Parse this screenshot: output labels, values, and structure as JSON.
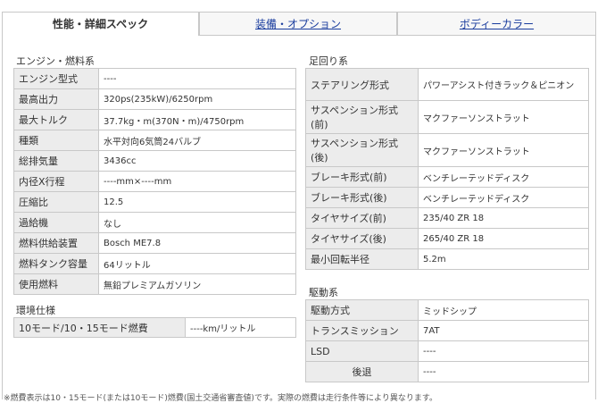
{
  "tabs": [
    {
      "label": "性能・詳細スペック"
    },
    {
      "label": "装備・オプション"
    },
    {
      "label": "ボディーカラー"
    }
  ],
  "engine": {
    "title": "エンジン・燃料系",
    "rows": [
      {
        "label": "エンジン型式",
        "value": "----"
      },
      {
        "label": "最高出力",
        "value": "320ps(235kW)/6250rpm"
      },
      {
        "label": "最大トルク",
        "value": "37.7kg・m(370N・m)/4750rpm"
      },
      {
        "label": "種類",
        "value": "水平対向6気筒24バルブ"
      },
      {
        "label": "総排気量",
        "value": "3436cc"
      },
      {
        "label": "内径X行程",
        "value": "----mm×----mm"
      },
      {
        "label": "圧縮比",
        "value": "12.5"
      },
      {
        "label": "過給機",
        "value": "なし"
      },
      {
        "label": "燃料供給装置",
        "value": "Bosch ME7.8"
      },
      {
        "label": "燃料タンク容量",
        "value": "64リットル"
      },
      {
        "label": "使用燃料",
        "value": "無鉛プレミアムガソリン"
      }
    ]
  },
  "environment": {
    "title": "環境仕様",
    "rows": [
      {
        "label": "10モード/10・15モード燃費",
        "value": "----km/リットル"
      }
    ]
  },
  "suspension": {
    "title": "足回り系",
    "rows": [
      {
        "label": "ステアリング形式",
        "value": "パワーアシスト付きラック＆ピニオン"
      },
      {
        "label": "サスペンション形式(前)",
        "value": "マクファーソンストラット"
      },
      {
        "label": "サスペンション形式(後)",
        "value": "マクファーソンストラット"
      },
      {
        "label": "ブレーキ形式(前)",
        "value": "ベンチレーテッドディスク"
      },
      {
        "label": "ブレーキ形式(後)",
        "value": "ベンチレーテッドディスク"
      },
      {
        "label": "タイヤサイズ(前)",
        "value": "235/40 ZR 18"
      },
      {
        "label": "タイヤサイズ(後)",
        "value": "265/40 ZR 18"
      },
      {
        "label": "最小回転半径",
        "value": "5.2m"
      }
    ]
  },
  "drive": {
    "title": "駆動系",
    "rows": [
      {
        "label": "駆動方式",
        "value": "ミッドシップ"
      },
      {
        "label": "トランスミッション",
        "value": "7AT"
      },
      {
        "label": "LSD",
        "value": "----"
      },
      {
        "label": "後退",
        "value": "----"
      }
    ]
  },
  "footnote": "※燃費表示は10・15モード(または10モード)燃費(国土交通省審査値)です。実際の燃費は走行条件等により異なります。"
}
